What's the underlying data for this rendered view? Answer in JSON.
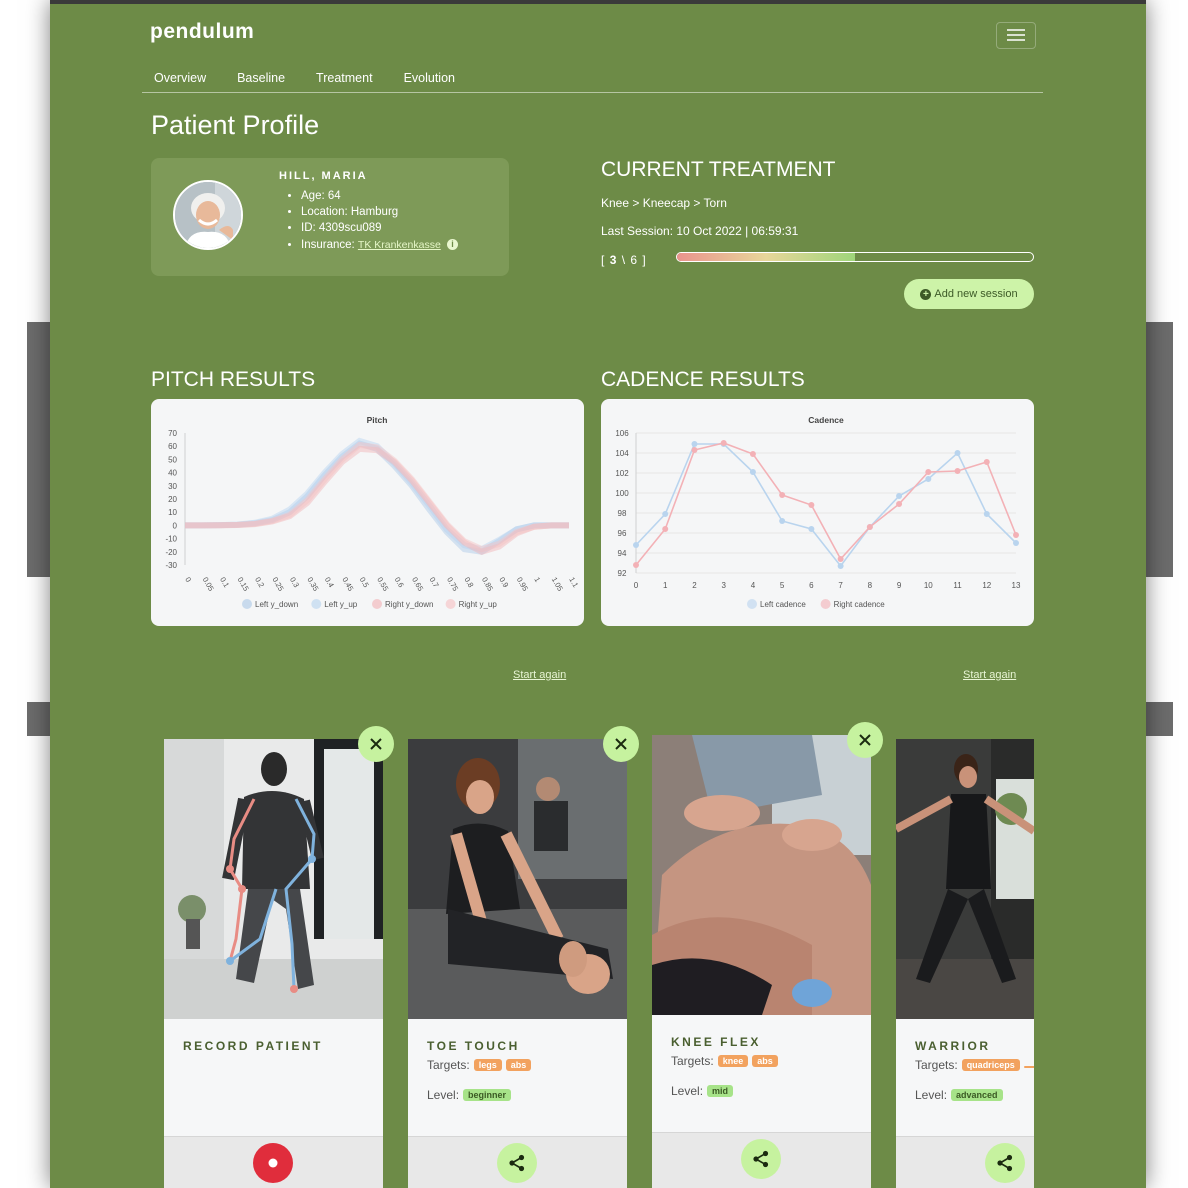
{
  "app": {
    "logo": "pendulum"
  },
  "nav": {
    "items": [
      "Overview",
      "Baseline",
      "Treatment",
      "Evolution"
    ]
  },
  "page": {
    "title": "Patient Profile"
  },
  "patient": {
    "name": "HILL, MARIA",
    "age": "Age: 64",
    "location": "Location: Hamburg",
    "id": "ID: 4309scu089",
    "insurance_label": "Insurance:",
    "insurance_value": "TK Krankenkasse"
  },
  "treatment": {
    "title": "CURRENT TREATMENT",
    "path": "Knee > Kneecap > Torn",
    "last_session": "Last Session: 10 Oct 2022 | 06:59:31",
    "session_open": "[",
    "session_current": "3",
    "session_rest": "\\ 6 ]",
    "progress": 0.5,
    "add_label": "Add new session"
  },
  "sections": {
    "pitch": "PITCH RESULTS",
    "cadence": "CADENCE RESULTS"
  },
  "links": {
    "start_again": "Start again"
  },
  "chart_data": [
    {
      "type": "line",
      "title": "Pitch",
      "x": [
        0,
        0.05,
        0.1,
        0.15,
        0.2,
        0.25,
        0.3,
        0.35,
        0.4,
        0.45,
        0.5,
        0.55,
        0.6,
        0.65,
        0.7,
        0.75,
        0.8,
        0.85,
        0.9,
        0.95,
        1,
        1.05,
        1.1
      ],
      "yticks": [
        70,
        60,
        50,
        40,
        30,
        20,
        10,
        0,
        -10,
        -20,
        -30
      ],
      "ylim": [
        -30,
        70
      ],
      "series": [
        {
          "name": "Left y_down",
          "color": "#aac8e6",
          "values": [
            0,
            0,
            0.2,
            0.5,
            1.5,
            4,
            10,
            22,
            38,
            52,
            62,
            58,
            45,
            30,
            12,
            -5,
            -18,
            -20,
            -12,
            -3,
            0,
            0,
            0
          ]
        },
        {
          "name": "Left y_up",
          "color": "#b6d3ef",
          "values": [
            0,
            0,
            0.2,
            0.6,
            2,
            5,
            12,
            24,
            40,
            54,
            64,
            60,
            47,
            32,
            15,
            -3,
            -15,
            -18,
            -11,
            -3,
            0,
            0,
            0
          ]
        },
        {
          "name": "Right y_down",
          "color": "#f2b1b4",
          "values": [
            0,
            0,
            0.1,
            0.3,
            1,
            3,
            7,
            17,
            33,
            48,
            58,
            57,
            48,
            34,
            17,
            0,
            -13,
            -20,
            -16,
            -6,
            -1,
            0,
            0
          ]
        },
        {
          "name": "Right y_up",
          "color": "#f6c0c2",
          "values": [
            0,
            0,
            0.1,
            0.4,
            1.2,
            3.5,
            8,
            19,
            35,
            50,
            61,
            59,
            49,
            35,
            18,
            1,
            -12,
            -18,
            -14,
            -5,
            -1,
            0,
            0
          ]
        }
      ]
    },
    {
      "type": "line",
      "title": "Cadence",
      "x": [
        0,
        1,
        2,
        3,
        4,
        5,
        6,
        7,
        8,
        9,
        10,
        11,
        12,
        13
      ],
      "yticks": [
        106,
        104,
        102,
        100,
        98,
        96,
        94,
        92
      ],
      "ylim": [
        92,
        106
      ],
      "series": [
        {
          "name": "Left cadence",
          "color": "#b9d4ee",
          "values": [
            94.8,
            97.9,
            104.9,
            104.9,
            102.1,
            97.2,
            96.4,
            92.7,
            96.6,
            99.7,
            101.4,
            104.0,
            97.9,
            95.0
          ]
        },
        {
          "name": "Right cadence",
          "color": "#f3b1b6",
          "values": [
            92.8,
            96.4,
            104.3,
            105.0,
            103.9,
            99.8,
            98.8,
            93.4,
            96.6,
            98.9,
            102.1,
            102.2,
            103.1,
            95.8
          ]
        }
      ]
    }
  ],
  "cards": [
    {
      "title": "RECORD PATIENT",
      "targets_label": "",
      "tags": [],
      "level_label": "",
      "level": ""
    },
    {
      "title": "TOE TOUCH",
      "targets_label": "Targets:",
      "tags": [
        "legs",
        "abs"
      ],
      "level_label": "Level:",
      "level": "beginner"
    },
    {
      "title": "KNEE FLEX",
      "targets_label": "Targets:",
      "tags": [
        "knee",
        "abs"
      ],
      "level_label": "Level:",
      "level": "mid"
    },
    {
      "title": "WARRIOR",
      "targets_label": "Targets:",
      "tags": [
        "quadriceps"
      ],
      "level_label": "Level:",
      "level": "advanced"
    }
  ],
  "colors": {
    "background": "#6d8b47",
    "card_panel": "#7e9a58",
    "accent_button": "#c6f29f",
    "record_red": "#e02d3c",
    "tag_orange": "#f2a25f",
    "tag_green": "#a7e389"
  },
  "icons": {
    "add": "plus-circle-icon",
    "close": "close-icon",
    "share": "share-icon",
    "record": "record-icon",
    "info": "info-icon",
    "menu": "hamburger-icon"
  }
}
